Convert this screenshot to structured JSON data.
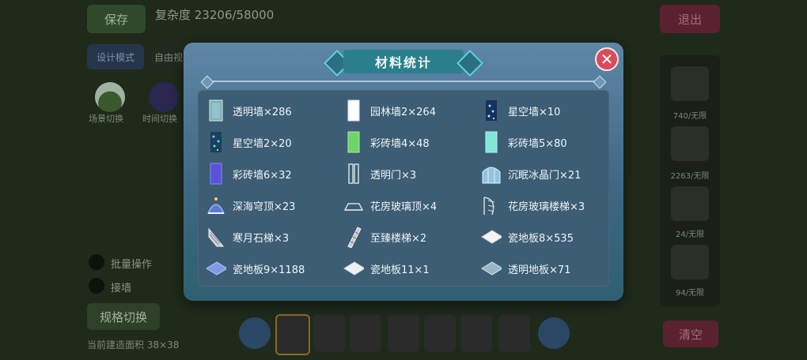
{
  "background": {
    "save_label": "保存",
    "complexity": "复杂度 23206/58000",
    "exit_label": "退出",
    "mode_label": "设计模式",
    "free_label": "自由视",
    "scene_switch": "场景切换",
    "time_switch": "时间切换",
    "batch_op": "批量操作",
    "wall_label": "接墙",
    "spec_switch": "规格切换",
    "build_area": "当前建造面积 38×38",
    "clear_label": "清空",
    "inventory": [
      "740/无限",
      "2263/无限",
      "24/无限",
      "94/无限"
    ]
  },
  "modal": {
    "title": "材料统计",
    "close_label": "✕",
    "items": [
      {
        "label": "透明墙×286",
        "icon": "transparent-wall-icon"
      },
      {
        "label": "园林墙2×264",
        "icon": "garden-wall-icon"
      },
      {
        "label": "星空墙×10",
        "icon": "starry-wall-icon"
      },
      {
        "label": "星空墙2×20",
        "icon": "starry-wall-2-icon"
      },
      {
        "label": "彩砖墙4×48",
        "icon": "color-brick-wall-4-icon"
      },
      {
        "label": "彩砖墙5×80",
        "icon": "color-brick-wall-5-icon"
      },
      {
        "label": "彩砖墙6×32",
        "icon": "color-brick-wall-6-icon"
      },
      {
        "label": "透明门×3",
        "icon": "transparent-door-icon"
      },
      {
        "label": "沉眠冰晶门×21",
        "icon": "ice-crystal-door-icon"
      },
      {
        "label": "深海穹顶×23",
        "icon": "deep-sea-dome-icon"
      },
      {
        "label": "花房玻璃顶×4",
        "icon": "greenhouse-glass-roof-icon"
      },
      {
        "label": "花房玻璃楼梯×3",
        "icon": "greenhouse-glass-stairs-icon"
      },
      {
        "label": "寒月石梯×3",
        "icon": "cold-moon-stone-stairs-icon"
      },
      {
        "label": "至臻楼梯×2",
        "icon": "supreme-stairs-icon"
      },
      {
        "label": "瓷地板8×535",
        "icon": "porcelain-floor-8-icon"
      },
      {
        "label": "瓷地板9×1188",
        "icon": "porcelain-floor-9-icon"
      },
      {
        "label": "瓷地板11×1",
        "icon": "porcelain-floor-11-icon"
      },
      {
        "label": "透明地板×71",
        "icon": "transparent-floor-icon"
      }
    ]
  }
}
